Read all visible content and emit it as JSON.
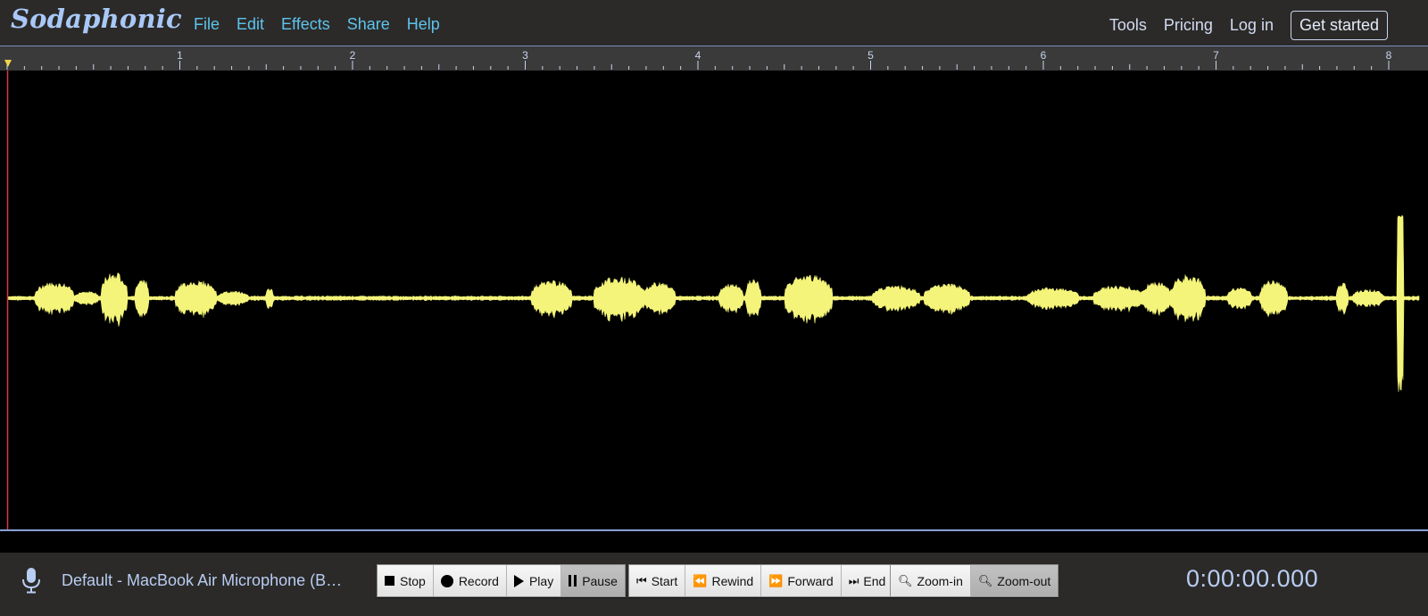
{
  "app": {
    "name": "Sodaphonic"
  },
  "nav": {
    "left": [
      "File",
      "Edit",
      "Effects",
      "Share",
      "Help"
    ],
    "right": [
      "Tools",
      "Pricing",
      "Log in"
    ],
    "cta": "Get started"
  },
  "ruler": {
    "labels": [
      "1",
      "2",
      "3",
      "4",
      "5",
      "6",
      "7",
      "8"
    ]
  },
  "waveform": {
    "color": "#f4f47a",
    "background": "#000000"
  },
  "toolbar": {
    "device": "Default - MacBook Air Microphone (B…",
    "transport": {
      "stop": "Stop",
      "record": "Record",
      "play": "Play",
      "pause": "Pause"
    },
    "seek": {
      "start": "Start",
      "rewind": "Rewind",
      "forward": "Forward",
      "end": "End"
    },
    "zoom": {
      "zoom_in": "Zoom-in",
      "zoom_out": "Zoom-out"
    },
    "time": "0:00:00.000"
  },
  "colors": {
    "accent": "#5ec3ec",
    "logo": "#a9c8f7",
    "background": "#2b2a28"
  }
}
